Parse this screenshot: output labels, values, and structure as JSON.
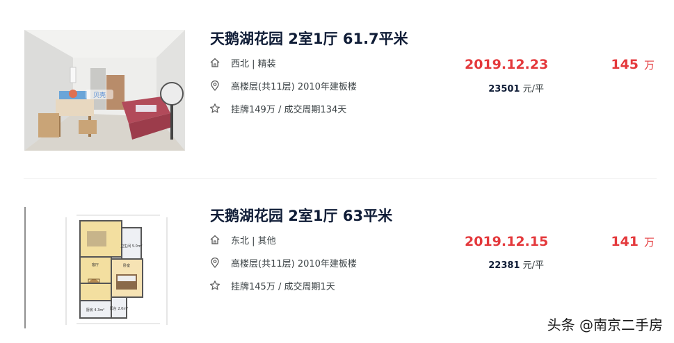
{
  "listings": [
    {
      "title": "天鹅湖花园 2室1厅 61.7平米",
      "orientation_decoration": "西北 | 精装",
      "floor_info": "高楼层(共11层) 2010年建板楼",
      "listing_info": "挂牌149万 / 成交周期134天",
      "deal_date": "2019.12.23",
      "unit_price_value": "23501",
      "unit_price_unit": "元/平",
      "total_price_value": "145",
      "total_price_unit": "万",
      "photo_watermark": "贝壳"
    },
    {
      "title": "天鹅湖花园 2室1厅 63平米",
      "orientation_decoration": "东北 | 其他",
      "floor_info": "高楼层(共11层) 2010年建板楼",
      "listing_info": "挂牌145万 / 成交周期1天",
      "deal_date": "2019.12.15",
      "unit_price_value": "22381",
      "unit_price_unit": "元/平",
      "total_price_value": "141",
      "total_price_unit": "万",
      "floorplan_labels": [
        "卫生间 5.0m²",
        "客厅",
        "卧室",
        "厨房 4.3m²",
        "阳台 2.0m²"
      ]
    }
  ],
  "icons": {
    "house": "house-icon",
    "location": "location-pin-icon",
    "star": "star-icon"
  },
  "colors": {
    "accent_red": "#e4393c",
    "title": "#101d37"
  },
  "watermark": "头条 @南京二手房"
}
